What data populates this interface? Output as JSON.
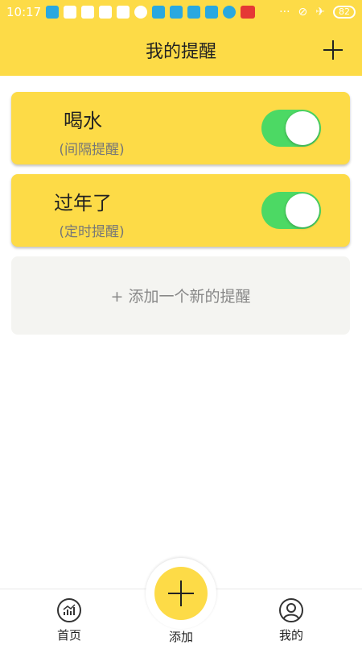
{
  "status_bar": {
    "time": "10:17",
    "battery": "82"
  },
  "header": {
    "title": "我的提醒",
    "add_icon": "plus-icon"
  },
  "reminders": [
    {
      "title": "喝水",
      "type": "(间隔提醒)",
      "enabled": true
    },
    {
      "title": "过年了",
      "type": "(定时提醒)",
      "enabled": true
    }
  ],
  "add_new": "+ 添加一个新的提醒",
  "tabbar": {
    "home": "首页",
    "add": "添加",
    "me": "我的"
  },
  "colors": {
    "accent": "#fddb47",
    "toggle_on": "#4cd964",
    "add_card_bg": "#f4f4f1"
  }
}
